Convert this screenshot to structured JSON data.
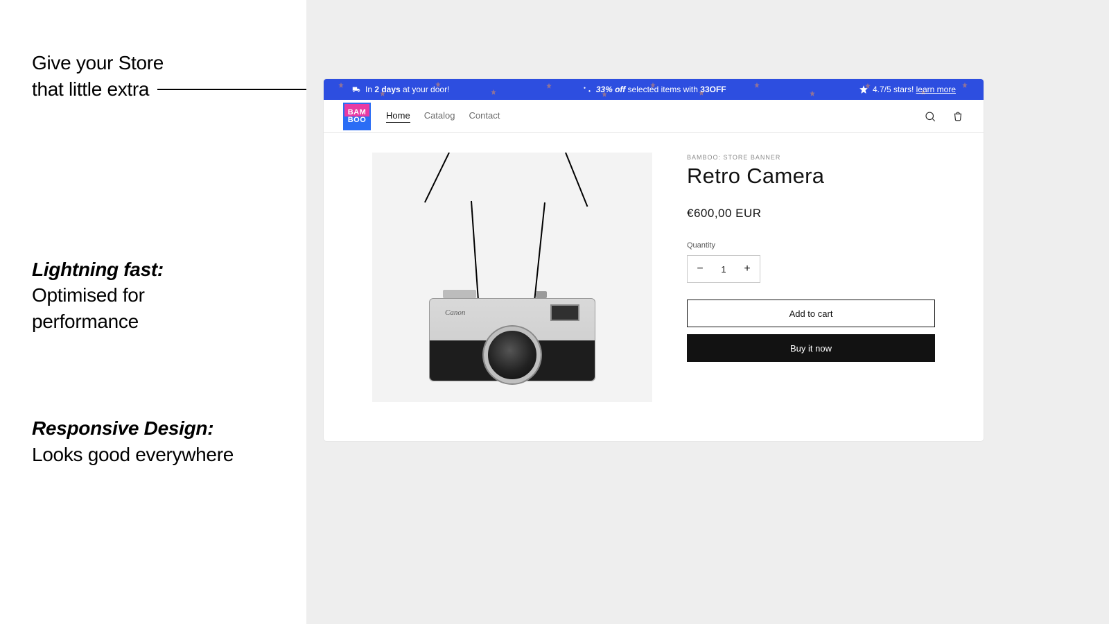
{
  "marketing": {
    "headline_l1": "Give your Store",
    "headline_l2": "that little extra",
    "feat2_em": "Lightning fast:",
    "feat2_l1": "Optimised for",
    "feat2_l2": "performance",
    "feat3_em": "Responsive Design:",
    "feat3_l1": "Looks good everywhere"
  },
  "banner": {
    "ship_prefix": "In ",
    "ship_bold": "2 days",
    "ship_suffix": " at your door!",
    "sale_pct": "33% off",
    "sale_mid": " selected items with ",
    "sale_code": "33OFF",
    "rating_text": "4.7/5 stars! ",
    "rating_link": "learn more"
  },
  "nav": {
    "logo_top": "BAM",
    "logo_bot": "BOO",
    "links": {
      "home": "Home",
      "catalog": "Catalog",
      "contact": "Contact"
    }
  },
  "product": {
    "vendor": "BAMBOO: STORE BANNER",
    "title": "Retro Camera",
    "price": "€600,00 EUR",
    "qty_label": "Quantity",
    "qty_value": "1",
    "add": "Add to cart",
    "buy": "Buy it now",
    "image_brand": "Canon"
  }
}
